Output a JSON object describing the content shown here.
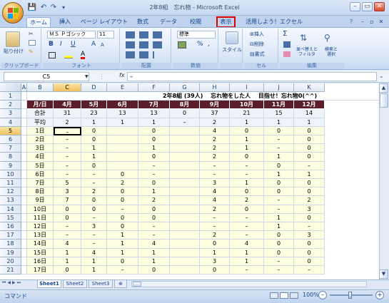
{
  "window": {
    "title": "2年8組　忘れ物 - Microsoft Excel",
    "minimize": "–",
    "restore": "▭",
    "close": "✕"
  },
  "qat": {
    "save": "💾",
    "undo": "↶",
    "redo": "↷",
    "more": "▾"
  },
  "tabs": [
    "ホーム",
    "挿入",
    "ページ レイアウト",
    "数式",
    "データ",
    "校閲",
    "表示",
    "活用しよう！エクセル"
  ],
  "ribbon": {
    "clipboard": {
      "paste": "貼り付け",
      "label": "クリップボード"
    },
    "font": {
      "name": "ＭＳ Ｐゴシック",
      "size": "11",
      "bold": "B",
      "italic": "I",
      "underline": "U",
      "grow": "A",
      "shrink": "A",
      "label": "フォント"
    },
    "alignment": {
      "label": "配置"
    },
    "number": {
      "format": "標準",
      "percent": "%",
      "comma": ",",
      "label": "数値"
    },
    "styles": {
      "styles": "スタイル",
      "label": ""
    },
    "cells": {
      "insert": "挿入",
      "delete": "削除",
      "format": "書式",
      "label": "セル"
    },
    "editing": {
      "sigma": "Σ",
      "sort": "並べ替えと\nフィルタ",
      "find": "検索と\n選択",
      "label": "編集"
    }
  },
  "formula": {
    "namebox": "C5",
    "fx": "fx",
    "value": "–"
  },
  "grid": {
    "columns": [
      "A",
      "B",
      "C",
      "D",
      "E",
      "F",
      "G",
      "H",
      "I",
      "J",
      "K"
    ],
    "selected_cell": "C5",
    "title": "2年8組 (39人)　 忘れ物をした人　 目指せ！忘れ物0(^^)",
    "header_row": [
      "月/日",
      "4月",
      "5月",
      "6月",
      "7月",
      "8月",
      "9月",
      "10月",
      "11月",
      "12月"
    ],
    "total_row": [
      "合計",
      "31",
      "23",
      "13",
      "13",
      "0",
      "37",
      "21",
      "15",
      "14"
    ],
    "avg_row": [
      "平均",
      "2",
      "1",
      "1",
      "1",
      "–",
      "2",
      "1",
      "1",
      "1"
    ],
    "rows": [
      {
        "num": "5",
        "cells": [
          "1日",
          "–",
          "0",
          "",
          "0",
          "",
          "4",
          "0",
          "0",
          "0"
        ]
      },
      {
        "num": "6",
        "cells": [
          "2日",
          "–",
          "0",
          "",
          "0",
          "",
          "2",
          "1",
          "–",
          "0"
        ]
      },
      {
        "num": "7",
        "cells": [
          "3日",
          "–",
          "1",
          "",
          "1",
          "",
          "2",
          "1",
          "–",
          "0"
        ]
      },
      {
        "num": "8",
        "cells": [
          "4日",
          "–",
          "1",
          "",
          "0",
          "",
          "2",
          "0",
          "1",
          "0"
        ]
      },
      {
        "num": "9",
        "cells": [
          "5日",
          "–",
          "0",
          "",
          "–",
          "",
          "–",
          "–",
          "0",
          "–"
        ]
      },
      {
        "num": "10",
        "cells": [
          "6日",
          "–",
          "–",
          "0",
          "–",
          "",
          "–",
          "–",
          "1",
          "1"
        ]
      },
      {
        "num": "11",
        "cells": [
          "7日",
          "5",
          "–",
          "2",
          "0",
          "",
          "3",
          "1",
          "0",
          "0"
        ]
      },
      {
        "num": "12",
        "cells": [
          "8日",
          "3",
          "2",
          "0",
          "1",
          "",
          "4",
          "0",
          "0",
          "0"
        ]
      },
      {
        "num": "13",
        "cells": [
          "9日",
          "7",
          "0",
          "0",
          "2",
          "",
          "4",
          "2",
          "–",
          "2"
        ]
      },
      {
        "num": "14",
        "cells": [
          "10日",
          "0",
          "0",
          "–",
          "0",
          "",
          "2",
          "0",
          "–",
          "3"
        ]
      },
      {
        "num": "15",
        "cells": [
          "11日",
          "0",
          "–",
          "0",
          "0",
          "",
          "–",
          "–",
          "1",
          "0"
        ]
      },
      {
        "num": "16",
        "cells": [
          "12日",
          "–",
          "3",
          "0",
          "–",
          "",
          "–",
          "–",
          "1",
          "–"
        ]
      },
      {
        "num": "17",
        "cells": [
          "13日",
          "–",
          "–",
          "1",
          "–",
          "",
          "2",
          "–",
          "0",
          "3"
        ]
      },
      {
        "num": "18",
        "cells": [
          "14日",
          "4",
          "–",
          "1",
          "4",
          "",
          "0",
          "4",
          "0",
          "0"
        ]
      },
      {
        "num": "19",
        "cells": [
          "15日",
          "1",
          "4",
          "1",
          "1",
          "",
          "1",
          "1",
          "0",
          "0"
        ]
      },
      {
        "num": "20",
        "cells": [
          "16日",
          "1",
          "1",
          "0",
          "1",
          "",
          "3",
          "1",
          "–",
          "0"
        ]
      },
      {
        "num": "21",
        "cells": [
          "17日",
          "0",
          "1",
          "–",
          "0",
          "",
          "0",
          "–",
          "–",
          "–"
        ]
      }
    ]
  },
  "sheets": [
    "Sheet1",
    "Sheet2",
    "Sheet3"
  ],
  "status": {
    "mode": "コマンド",
    "zoom": "100%"
  },
  "colors": {
    "header_bg": "#5a1f28",
    "highlight": "#e00000",
    "yellow_cell": "#fefee0"
  }
}
